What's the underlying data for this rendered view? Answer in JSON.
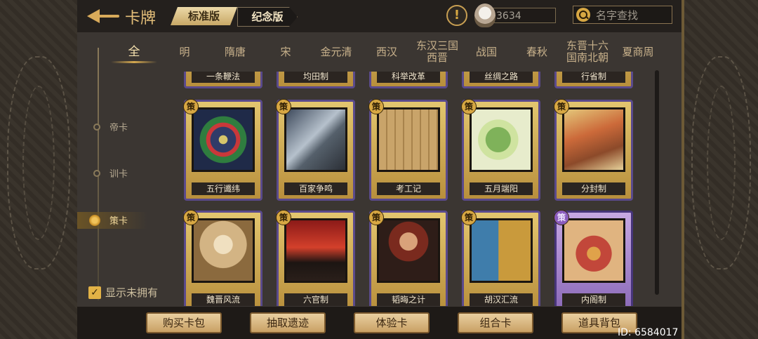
{
  "header": {
    "title": "卡牌",
    "version_tabs": [
      "标准版",
      "纪念版"
    ],
    "warning_glyph": "!",
    "coins": "3634",
    "search_placeholder": "名字查找"
  },
  "era_tabs": [
    "全",
    "明",
    "隋唐",
    "宋",
    "金元清",
    "西汉",
    "东汉三国西晋",
    "战国",
    "春秋",
    "东晋十六国南北朝",
    "夏商周"
  ],
  "era_active": "全",
  "categories": [
    "帝卡",
    "训卡",
    "策卡"
  ],
  "category_active": "策卡",
  "show_unowned": {
    "label": "显示未拥有",
    "checked": true
  },
  "cards_partial_row": [
    "一条鞭法",
    "均田制",
    "科举改革",
    "丝绸之路",
    "行省制"
  ],
  "cards_row1": [
    {
      "badge": "策",
      "name": "五行谶纬",
      "rarity": "gold"
    },
    {
      "badge": "策",
      "name": "百家争鸣",
      "rarity": "gold"
    },
    {
      "badge": "策",
      "name": "考工记",
      "rarity": "gold"
    },
    {
      "badge": "策",
      "name": "五月端阳",
      "rarity": "gold"
    },
    {
      "badge": "策",
      "name": "分封制",
      "rarity": "gold"
    }
  ],
  "cards_row2": [
    {
      "badge": "策",
      "name": "魏晋风流",
      "rarity": "gold"
    },
    {
      "badge": "策",
      "name": "六官制",
      "rarity": "gold"
    },
    {
      "badge": "策",
      "name": "韬晦之计",
      "rarity": "gold"
    },
    {
      "badge": "策",
      "name": "胡汉汇流",
      "rarity": "gold"
    },
    {
      "badge": "策",
      "name": "内阁制",
      "rarity": "purple"
    }
  ],
  "bottom_buttons": [
    "购买卡包",
    "抽取遗迹",
    "体验卡",
    "组合卡",
    "道具背包"
  ],
  "player_id": "ID: 6584017",
  "colors": {
    "accent_gold": "#e2b246",
    "card_border_blue": "#5a4a8c",
    "card_purple": "#8b6ab8"
  }
}
